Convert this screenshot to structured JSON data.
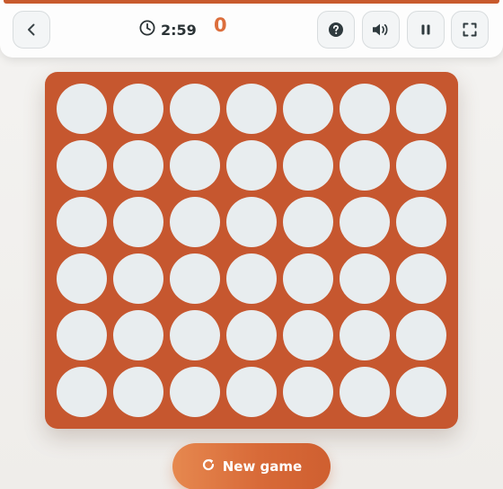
{
  "header": {
    "timer": "2:59",
    "score": "0",
    "icons": {
      "back": "chevron-left-icon",
      "timer": "clock-icon",
      "help": "question-icon",
      "sound": "speaker-icon",
      "pause": "pause-icon",
      "fullscreen": "fullscreen-icon"
    }
  },
  "board": {
    "columns": 7,
    "rows": 6,
    "empty_color": "#e8edef",
    "board_color": "#c6572f"
  },
  "actions": {
    "new_game_label": "New game",
    "new_game_icon": "restart-icon"
  },
  "theme": {
    "accent": "#dc6e3c",
    "text": "#2b3336"
  }
}
